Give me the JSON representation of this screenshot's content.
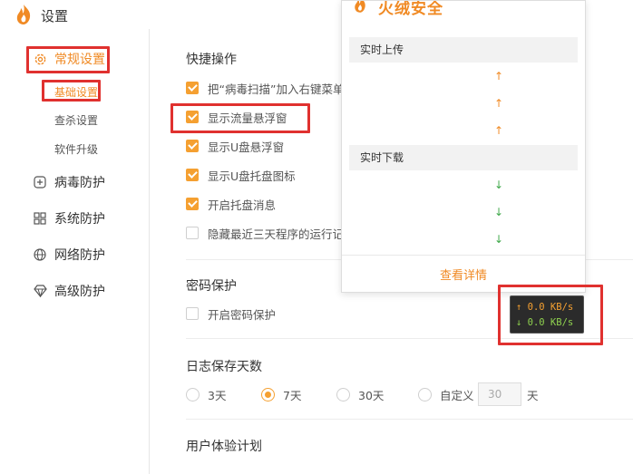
{
  "window": {
    "title": "设置"
  },
  "sidebar": {
    "categories": [
      {
        "label": "常规设置",
        "icon": "gear-icon"
      },
      {
        "label": "病毒防护",
        "icon": "plus-square-icon"
      },
      {
        "label": "系统防护",
        "icon": "grid-icon"
      },
      {
        "label": "网络防护",
        "icon": "globe-icon"
      },
      {
        "label": "高级防护",
        "icon": "diamond-icon"
      }
    ],
    "subitems": [
      "基础设置",
      "查杀设置",
      "软件升级"
    ]
  },
  "shortcuts": {
    "title": "快捷操作",
    "options": [
      {
        "label": "把“病毒扫描”加入右键菜单",
        "checked": true
      },
      {
        "label": "显示流量悬浮窗",
        "checked": true
      },
      {
        "label": "显示U盘悬浮窗",
        "checked": true
      },
      {
        "label": "显示U盘托盘图标",
        "checked": true
      },
      {
        "label": "开启托盘消息",
        "checked": true
      },
      {
        "label": "隐藏最近三天程序的运行记录",
        "checked": false
      }
    ]
  },
  "password": {
    "title": "密码保护",
    "option": {
      "label": "开启密码保护",
      "checked": false
    }
  },
  "log": {
    "title": "日志保存天数",
    "options": [
      "3天",
      "7天",
      "30天",
      "自定义"
    ],
    "selected": "7天",
    "custom_value": "30",
    "unit": "天"
  },
  "experience": {
    "title": "用户体验计划"
  },
  "float_panel": {
    "brand": "火绒安全",
    "upload_label": "实时上传",
    "download_label": "实时下载",
    "up_arrow": "↑",
    "down_arrow": "↓",
    "details_link": "查看详情"
  },
  "speed_widget": {
    "upload": "↑ 0.0 KB/s",
    "download": "↓ 0.0 KB/s"
  },
  "colors": {
    "accent": "#f08a24",
    "checkbox": "#f5a031",
    "highlight": "#e0312f",
    "download_green": "#3fa84a"
  }
}
